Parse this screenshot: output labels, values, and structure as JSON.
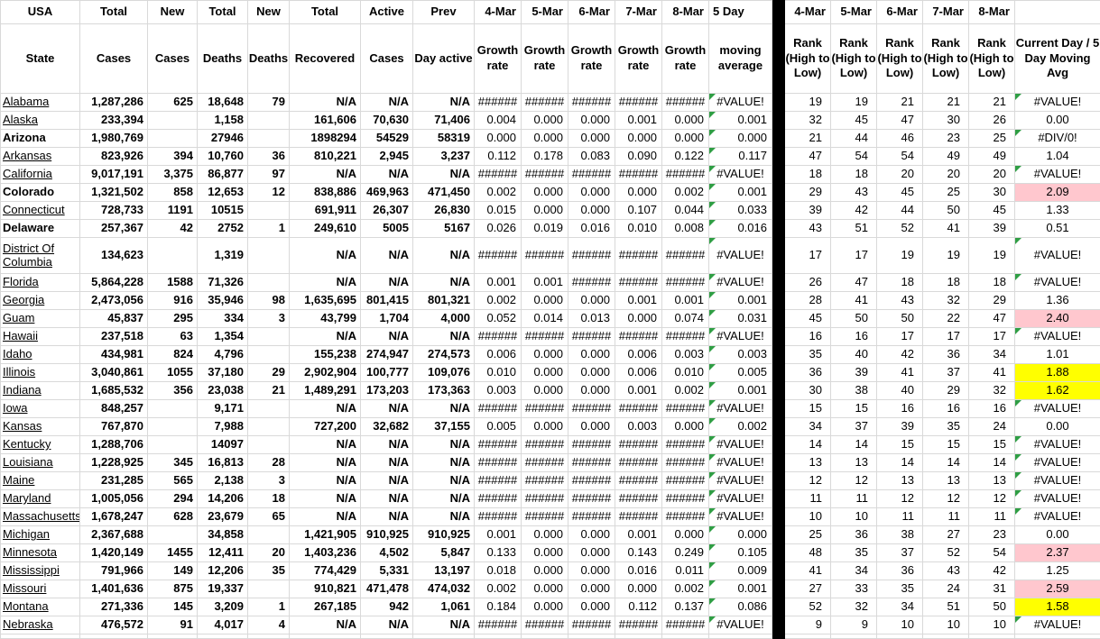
{
  "colors": {
    "grid": "#d9d9d9",
    "separator": "#000000",
    "highlight_pink": "#ffc7ce",
    "highlight_yellow": "#ffff00",
    "error_indicator_green": "#2f9e44"
  },
  "table": {
    "header_row1": [
      "USA",
      "Total",
      "New",
      "Total",
      "New",
      "Total",
      "Active",
      "Prev",
      "4-Mar",
      "5-Mar",
      "6-Mar",
      "7-Mar",
      "8-Mar",
      "5 Day",
      "",
      "4-Mar",
      "5-Mar",
      "6-Mar",
      "7-Mar",
      "8-Mar",
      ""
    ],
    "header_row2": [
      "State",
      "Cases",
      "Cases",
      "Deaths",
      "Deaths",
      "Recovered",
      "Cases",
      "Day active",
      "Growth rate",
      "Growth rate",
      "Growth rate",
      "Growth rate",
      "Growth rate",
      "moving average",
      "",
      "Rank (High to Low)",
      "Rank (High to Low)",
      "Rank (High to Low)",
      "Rank (High to Low)",
      "Rank (High to Low)",
      "Current Day / 5 Day Moving Avg"
    ],
    "avg_indicator_all_rows": true,
    "rows": [
      {
        "state": "Alabama",
        "state_style": "link",
        "cases": "1,287,286",
        "new_cases": "625",
        "deaths": "18,648",
        "new_deaths": "79",
        "recovered": "N/A",
        "active": "N/A",
        "prev": "N/A",
        "growth": [
          "######",
          "######",
          "######",
          "######",
          "######"
        ],
        "avg": "#VALUE!",
        "ranks": [
          "19",
          "19",
          "21",
          "21",
          "21"
        ],
        "current": "#VALUE!",
        "current_bg": "",
        "current_tri": true
      },
      {
        "state": "Alaska",
        "state_style": "link",
        "cases": "233,394",
        "new_cases": "",
        "deaths": "1,158",
        "new_deaths": "",
        "recovered": "161,606",
        "active": "70,630",
        "prev": "71,406",
        "growth": [
          "0.004",
          "0.000",
          "0.000",
          "0.001",
          "0.000"
        ],
        "avg": "0.001",
        "ranks": [
          "32",
          "45",
          "47",
          "30",
          "26"
        ],
        "current": "0.00",
        "current_bg": "",
        "current_tri": false
      },
      {
        "state": "Arizona",
        "state_style": "bold",
        "cases": "1,980,769",
        "new_cases": "",
        "deaths": "27946",
        "new_deaths": "",
        "recovered": "1898294",
        "active": "54529",
        "prev": "58319",
        "growth": [
          "0.000",
          "0.000",
          "0.000",
          "0.000",
          "0.000"
        ],
        "avg": "0.000",
        "ranks": [
          "21",
          "44",
          "46",
          "23",
          "25"
        ],
        "current": "#DIV/0!",
        "current_bg": "",
        "current_tri": true
      },
      {
        "state": "Arkansas",
        "state_style": "link",
        "cases": "823,926",
        "new_cases": "394",
        "deaths": "10,760",
        "new_deaths": "36",
        "recovered": "810,221",
        "active": "2,945",
        "prev": "3,237",
        "growth": [
          "0.112",
          "0.178",
          "0.083",
          "0.090",
          "0.122"
        ],
        "avg": "0.117",
        "ranks": [
          "47",
          "54",
          "54",
          "49",
          "49"
        ],
        "current": "1.04",
        "current_bg": "",
        "current_tri": false
      },
      {
        "state": "California",
        "state_style": "link",
        "cases": "9,017,191",
        "new_cases": "3,375",
        "deaths": "86,877",
        "new_deaths": "97",
        "recovered": "N/A",
        "active": "N/A",
        "prev": "N/A",
        "growth": [
          "######",
          "######",
          "######",
          "######",
          "######"
        ],
        "avg": "#VALUE!",
        "ranks": [
          "18",
          "18",
          "20",
          "20",
          "20"
        ],
        "current": "#VALUE!",
        "current_bg": "",
        "current_tri": true
      },
      {
        "state": "Colorado",
        "state_style": "bold",
        "cases": "1,321,502",
        "new_cases": "858",
        "deaths": "12,653",
        "new_deaths": "12",
        "recovered": "838,886",
        "active": "469,963",
        "prev": "471,450",
        "growth": [
          "0.002",
          "0.000",
          "0.000",
          "0.000",
          "0.002"
        ],
        "avg": "0.001",
        "ranks": [
          "29",
          "43",
          "45",
          "25",
          "30"
        ],
        "current": "2.09",
        "current_bg": "pink",
        "current_tri": false
      },
      {
        "state": "Connecticut",
        "state_style": "link",
        "cases": "728,733",
        "new_cases": "1191",
        "deaths": "10515",
        "new_deaths": "",
        "recovered": "691,911",
        "active": "26,307",
        "prev": "26,830",
        "growth": [
          "0.015",
          "0.000",
          "0.000",
          "0.107",
          "0.044"
        ],
        "avg": "0.033",
        "ranks": [
          "39",
          "42",
          "44",
          "50",
          "45"
        ],
        "current": "1.33",
        "current_bg": "",
        "current_tri": false
      },
      {
        "state": "Delaware",
        "state_style": "bold",
        "cases": "257,367",
        "new_cases": "42",
        "deaths": "2752",
        "new_deaths": "1",
        "recovered": "249,610",
        "active": "5005",
        "prev": "5167",
        "growth": [
          "0.026",
          "0.019",
          "0.016",
          "0.010",
          "0.008"
        ],
        "avg": "0.016",
        "ranks": [
          "43",
          "51",
          "52",
          "41",
          "39"
        ],
        "current": "0.51",
        "current_bg": "",
        "current_tri": false
      },
      {
        "state": "District Of Columbia",
        "state_style": "link",
        "tall": true,
        "cases": "134,623",
        "new_cases": "",
        "deaths": "1,319",
        "new_deaths": "",
        "recovered": "N/A",
        "active": "N/A",
        "prev": "N/A",
        "growth": [
          "######",
          "######",
          "######",
          "######",
          "######"
        ],
        "avg": "#VALUE!",
        "ranks": [
          "17",
          "17",
          "19",
          "19",
          "19"
        ],
        "current": "#VALUE!",
        "current_bg": "",
        "current_tri": true
      },
      {
        "state": "Florida",
        "state_style": "link",
        "cases": "5,864,228",
        "new_cases": "1588",
        "deaths": "71,326",
        "new_deaths": "",
        "recovered": "N/A",
        "active": "N/A",
        "prev": "N/A",
        "growth": [
          "0.001",
          "0.001",
          "######",
          "######",
          "######"
        ],
        "avg": "#VALUE!",
        "ranks": [
          "26",
          "47",
          "18",
          "18",
          "18"
        ],
        "current": "#VALUE!",
        "current_bg": "",
        "current_tri": true
      },
      {
        "state": "Georgia",
        "state_style": "link",
        "cases": "2,473,056",
        "new_cases": "916",
        "deaths": "35,946",
        "new_deaths": "98",
        "recovered": "1,635,695",
        "active": "801,415",
        "prev": "801,321",
        "growth": [
          "0.002",
          "0.000",
          "0.000",
          "0.001",
          "0.001"
        ],
        "avg": "0.001",
        "ranks": [
          "28",
          "41",
          "43",
          "32",
          "29"
        ],
        "current": "1.36",
        "current_bg": "",
        "current_tri": false
      },
      {
        "state": "Guam",
        "state_style": "link",
        "cases": "45,837",
        "new_cases": "295",
        "deaths": "334",
        "new_deaths": "3",
        "recovered": "43,799",
        "active": "1,704",
        "prev": "4,000",
        "growth": [
          "0.052",
          "0.014",
          "0.013",
          "0.000",
          "0.074"
        ],
        "avg": "0.031",
        "ranks": [
          "45",
          "50",
          "50",
          "22",
          "47"
        ],
        "current": "2.40",
        "current_bg": "pink",
        "current_tri": false
      },
      {
        "state": "Hawaii",
        "state_style": "link",
        "cases": "237,518",
        "new_cases": "63",
        "deaths": "1,354",
        "new_deaths": "",
        "recovered": "N/A",
        "active": "N/A",
        "prev": "N/A",
        "growth": [
          "######",
          "######",
          "######",
          "######",
          "######"
        ],
        "avg": "#VALUE!",
        "ranks": [
          "16",
          "16",
          "17",
          "17",
          "17"
        ],
        "current": "#VALUE!",
        "current_bg": "",
        "current_tri": true
      },
      {
        "state": "Idaho",
        "state_style": "link",
        "cases": "434,981",
        "new_cases": "824",
        "deaths": "4,796",
        "new_deaths": "",
        "recovered": "155,238",
        "active": "274,947",
        "prev": "274,573",
        "growth": [
          "0.006",
          "0.000",
          "0.000",
          "0.006",
          "0.003"
        ],
        "avg": "0.003",
        "ranks": [
          "35",
          "40",
          "42",
          "36",
          "34"
        ],
        "current": "1.01",
        "current_bg": "",
        "current_tri": false
      },
      {
        "state": "Illinois",
        "state_style": "link",
        "cases": "3,040,861",
        "new_cases": "1055",
        "deaths": "37,180",
        "new_deaths": "29",
        "recovered": "2,902,904",
        "active": "100,777",
        "prev": "109,076",
        "growth": [
          "0.010",
          "0.000",
          "0.000",
          "0.006",
          "0.010"
        ],
        "avg": "0.005",
        "ranks": [
          "36",
          "39",
          "41",
          "37",
          "41"
        ],
        "current": "1.88",
        "current_bg": "yellow",
        "current_tri": false
      },
      {
        "state": "Indiana",
        "state_style": "link",
        "cases": "1,685,532",
        "new_cases": "356",
        "deaths": "23,038",
        "new_deaths": "21",
        "recovered": "1,489,291",
        "active": "173,203",
        "prev": "173,363",
        "growth": [
          "0.003",
          "0.000",
          "0.000",
          "0.001",
          "0.002"
        ],
        "avg": "0.001",
        "ranks": [
          "30",
          "38",
          "40",
          "29",
          "32"
        ],
        "current": "1.62",
        "current_bg": "yellow",
        "current_tri": false
      },
      {
        "state": "Iowa",
        "state_style": "link",
        "cases": "848,257",
        "new_cases": "",
        "deaths": "9,171",
        "new_deaths": "",
        "recovered": "N/A",
        "active": "N/A",
        "prev": "N/A",
        "growth": [
          "######",
          "######",
          "######",
          "######",
          "######"
        ],
        "avg": "#VALUE!",
        "ranks": [
          "15",
          "15",
          "16",
          "16",
          "16"
        ],
        "current": "#VALUE!",
        "current_bg": "",
        "current_tri": true
      },
      {
        "state": "Kansas",
        "state_style": "link",
        "cases": "767,870",
        "new_cases": "",
        "deaths": "7,988",
        "new_deaths": "",
        "recovered": "727,200",
        "active": "32,682",
        "prev": "37,155",
        "growth": [
          "0.005",
          "0.000",
          "0.000",
          "0.003",
          "0.000"
        ],
        "avg": "0.002",
        "ranks": [
          "34",
          "37",
          "39",
          "35",
          "24"
        ],
        "current": "0.00",
        "current_bg": "",
        "current_tri": false
      },
      {
        "state": "Kentucky",
        "state_style": "link",
        "cases": "1,288,706",
        "new_cases": "",
        "deaths": "14097",
        "new_deaths": "",
        "recovered": "N/A",
        "active": "N/A",
        "prev": "N/A",
        "growth": [
          "######",
          "######",
          "######",
          "######",
          "######"
        ],
        "avg": "#VALUE!",
        "ranks": [
          "14",
          "14",
          "15",
          "15",
          "15"
        ],
        "current": "#VALUE!",
        "current_bg": "",
        "current_tri": true
      },
      {
        "state": "Louisiana",
        "state_style": "link",
        "cases": "1,228,925",
        "new_cases": "345",
        "deaths": "16,813",
        "new_deaths": "28",
        "recovered": "N/A",
        "active": "N/A",
        "prev": "N/A",
        "growth": [
          "######",
          "######",
          "######",
          "######",
          "######"
        ],
        "avg": "#VALUE!",
        "ranks": [
          "13",
          "13",
          "14",
          "14",
          "14"
        ],
        "current": "#VALUE!",
        "current_bg": "",
        "current_tri": true
      },
      {
        "state": "Maine",
        "state_style": "link",
        "cases": "231,285",
        "new_cases": "565",
        "deaths": "2,138",
        "new_deaths": "3",
        "recovered": "N/A",
        "active": "N/A",
        "prev": "N/A",
        "growth": [
          "######",
          "######",
          "######",
          "######",
          "######"
        ],
        "avg": "#VALUE!",
        "ranks": [
          "12",
          "12",
          "13",
          "13",
          "13"
        ],
        "current": "#VALUE!",
        "current_bg": "",
        "current_tri": true
      },
      {
        "state": "Maryland",
        "state_style": "link",
        "cases": "1,005,056",
        "new_cases": "294",
        "deaths": "14,206",
        "new_deaths": "18",
        "recovered": "N/A",
        "active": "N/A",
        "prev": "N/A",
        "growth": [
          "######",
          "######",
          "######",
          "######",
          "######"
        ],
        "avg": "#VALUE!",
        "ranks": [
          "11",
          "11",
          "12",
          "12",
          "12"
        ],
        "current": "#VALUE!",
        "current_bg": "",
        "current_tri": true
      },
      {
        "state": "Massachusetts",
        "state_style": "link",
        "cases": "1,678,247",
        "new_cases": "628",
        "deaths": "23,679",
        "new_deaths": "65",
        "recovered": "N/A",
        "active": "N/A",
        "prev": "N/A",
        "growth": [
          "######",
          "######",
          "######",
          "######",
          "######"
        ],
        "avg": "#VALUE!",
        "ranks": [
          "10",
          "10",
          "11",
          "11",
          "11"
        ],
        "current": "#VALUE!",
        "current_bg": "",
        "current_tri": true
      },
      {
        "state": "Michigan",
        "state_style": "link",
        "cases": "2,367,688",
        "new_cases": "",
        "deaths": "34,858",
        "new_deaths": "",
        "recovered": "1,421,905",
        "active": "910,925",
        "prev": "910,925",
        "growth": [
          "0.001",
          "0.000",
          "0.000",
          "0.001",
          "0.000"
        ],
        "avg": "0.000",
        "ranks": [
          "25",
          "36",
          "38",
          "27",
          "23"
        ],
        "current": "0.00",
        "current_bg": "",
        "current_tri": false
      },
      {
        "state": "Minnesota",
        "state_style": "link",
        "cases": "1,420,149",
        "new_cases": "1455",
        "deaths": "12,411",
        "new_deaths": "20",
        "recovered": "1,403,236",
        "active": "4,502",
        "prev": "5,847",
        "growth": [
          "0.133",
          "0.000",
          "0.000",
          "0.143",
          "0.249"
        ],
        "avg": "0.105",
        "ranks": [
          "48",
          "35",
          "37",
          "52",
          "54"
        ],
        "current": "2.37",
        "current_bg": "pink",
        "current_tri": false
      },
      {
        "state": "Mississippi",
        "state_style": "link",
        "cases": "791,966",
        "new_cases": "149",
        "deaths": "12,206",
        "new_deaths": "35",
        "recovered": "774,429",
        "active": "5,331",
        "prev": "13,197",
        "growth": [
          "0.018",
          "0.000",
          "0.000",
          "0.016",
          "0.011"
        ],
        "avg": "0.009",
        "ranks": [
          "41",
          "34",
          "36",
          "43",
          "42"
        ],
        "current": "1.25",
        "current_bg": "",
        "current_tri": false
      },
      {
        "state": "Missouri",
        "state_style": "link",
        "cases": "1,401,636",
        "new_cases": "875",
        "deaths": "19,337",
        "new_deaths": "",
        "recovered": "910,821",
        "active": "471,478",
        "prev": "474,032",
        "growth": [
          "0.002",
          "0.000",
          "0.000",
          "0.000",
          "0.002"
        ],
        "avg": "0.001",
        "ranks": [
          "27",
          "33",
          "35",
          "24",
          "31"
        ],
        "current": "2.59",
        "current_bg": "pink",
        "current_tri": false
      },
      {
        "state": "Montana",
        "state_style": "link",
        "cases": "271,336",
        "new_cases": "145",
        "deaths": "3,209",
        "new_deaths": "1",
        "recovered": "267,185",
        "active": "942",
        "prev": "1,061",
        "growth": [
          "0.184",
          "0.000",
          "0.000",
          "0.112",
          "0.137"
        ],
        "avg": "0.086",
        "ranks": [
          "52",
          "32",
          "34",
          "51",
          "50"
        ],
        "current": "1.58",
        "current_bg": "yellow",
        "current_tri": false
      },
      {
        "state": "Nebraska",
        "state_style": "link",
        "cases": "476,572",
        "new_cases": "91",
        "deaths": "4,017",
        "new_deaths": "4",
        "recovered": "N/A",
        "active": "N/A",
        "prev": "N/A",
        "growth": [
          "######",
          "######",
          "######",
          "######",
          "######"
        ],
        "avg": "#VALUE!",
        "ranks": [
          "9",
          "9",
          "10",
          "10",
          "10"
        ],
        "current": "#VALUE!",
        "current_bg": "",
        "current_tri": true
      }
    ]
  }
}
